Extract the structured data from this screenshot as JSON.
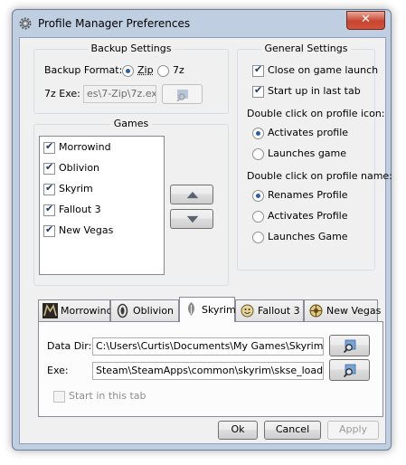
{
  "window": {
    "title": "Profile Manager Preferences",
    "close_glyph": "✕"
  },
  "backup": {
    "title": "Backup Settings",
    "format_label": "Backup Format:",
    "options": [
      "Zip",
      "7z"
    ],
    "selected": "Zip",
    "exe_label": "7z Exe:",
    "exe_value": "es\\7-Zip\\7z.exe"
  },
  "general": {
    "title": "General Settings",
    "close_on_launch": "Close on game launch",
    "start_last_tab": "Start up in last tab",
    "icon_dbl_label": "Double click on profile icon:",
    "icon_options": [
      "Activates profile",
      "Launches game"
    ],
    "icon_selected": "Activates profile",
    "name_dbl_label": "Double click on profile name:",
    "name_options": [
      "Renames Profile",
      "Activates Profile",
      "Launches Game"
    ],
    "name_selected": "Renames Profile"
  },
  "games": {
    "title": "Games",
    "items": [
      "Morrowind",
      "Oblivion",
      "Skyrim",
      "Fallout 3",
      "New Vegas"
    ]
  },
  "tabs": {
    "items": [
      "Morrowind",
      "Oblivion",
      "Skyrim",
      "Fallout 3",
      "New Vegas"
    ],
    "active": "Skyrim"
  },
  "skyrim_panel": {
    "data_dir_label": "Data Dir:",
    "data_dir_value": "C:\\Users\\Curtis\\Documents\\My Games\\Skyrim\\",
    "exe_label": "Exe:",
    "exe_value": "Steam\\SteamApps\\common\\skyrim\\skse_loader.exe",
    "start_in_tab": "Start in this tab"
  },
  "buttons": {
    "ok": "Ok",
    "cancel": "Cancel",
    "apply": "Apply"
  },
  "colors": {
    "frame": "#bfcfe1",
    "client": "#f0f0f0",
    "close": "#c8442f",
    "accent": "#2a5fa7"
  },
  "icons": [
    "gear-icon",
    "folder-browse-icon",
    "arrow-up-icon",
    "arrow-down-icon",
    "morrowind-icon",
    "oblivion-icon",
    "skyrim-icon",
    "fallout-icon",
    "new-vegas-icon"
  ]
}
